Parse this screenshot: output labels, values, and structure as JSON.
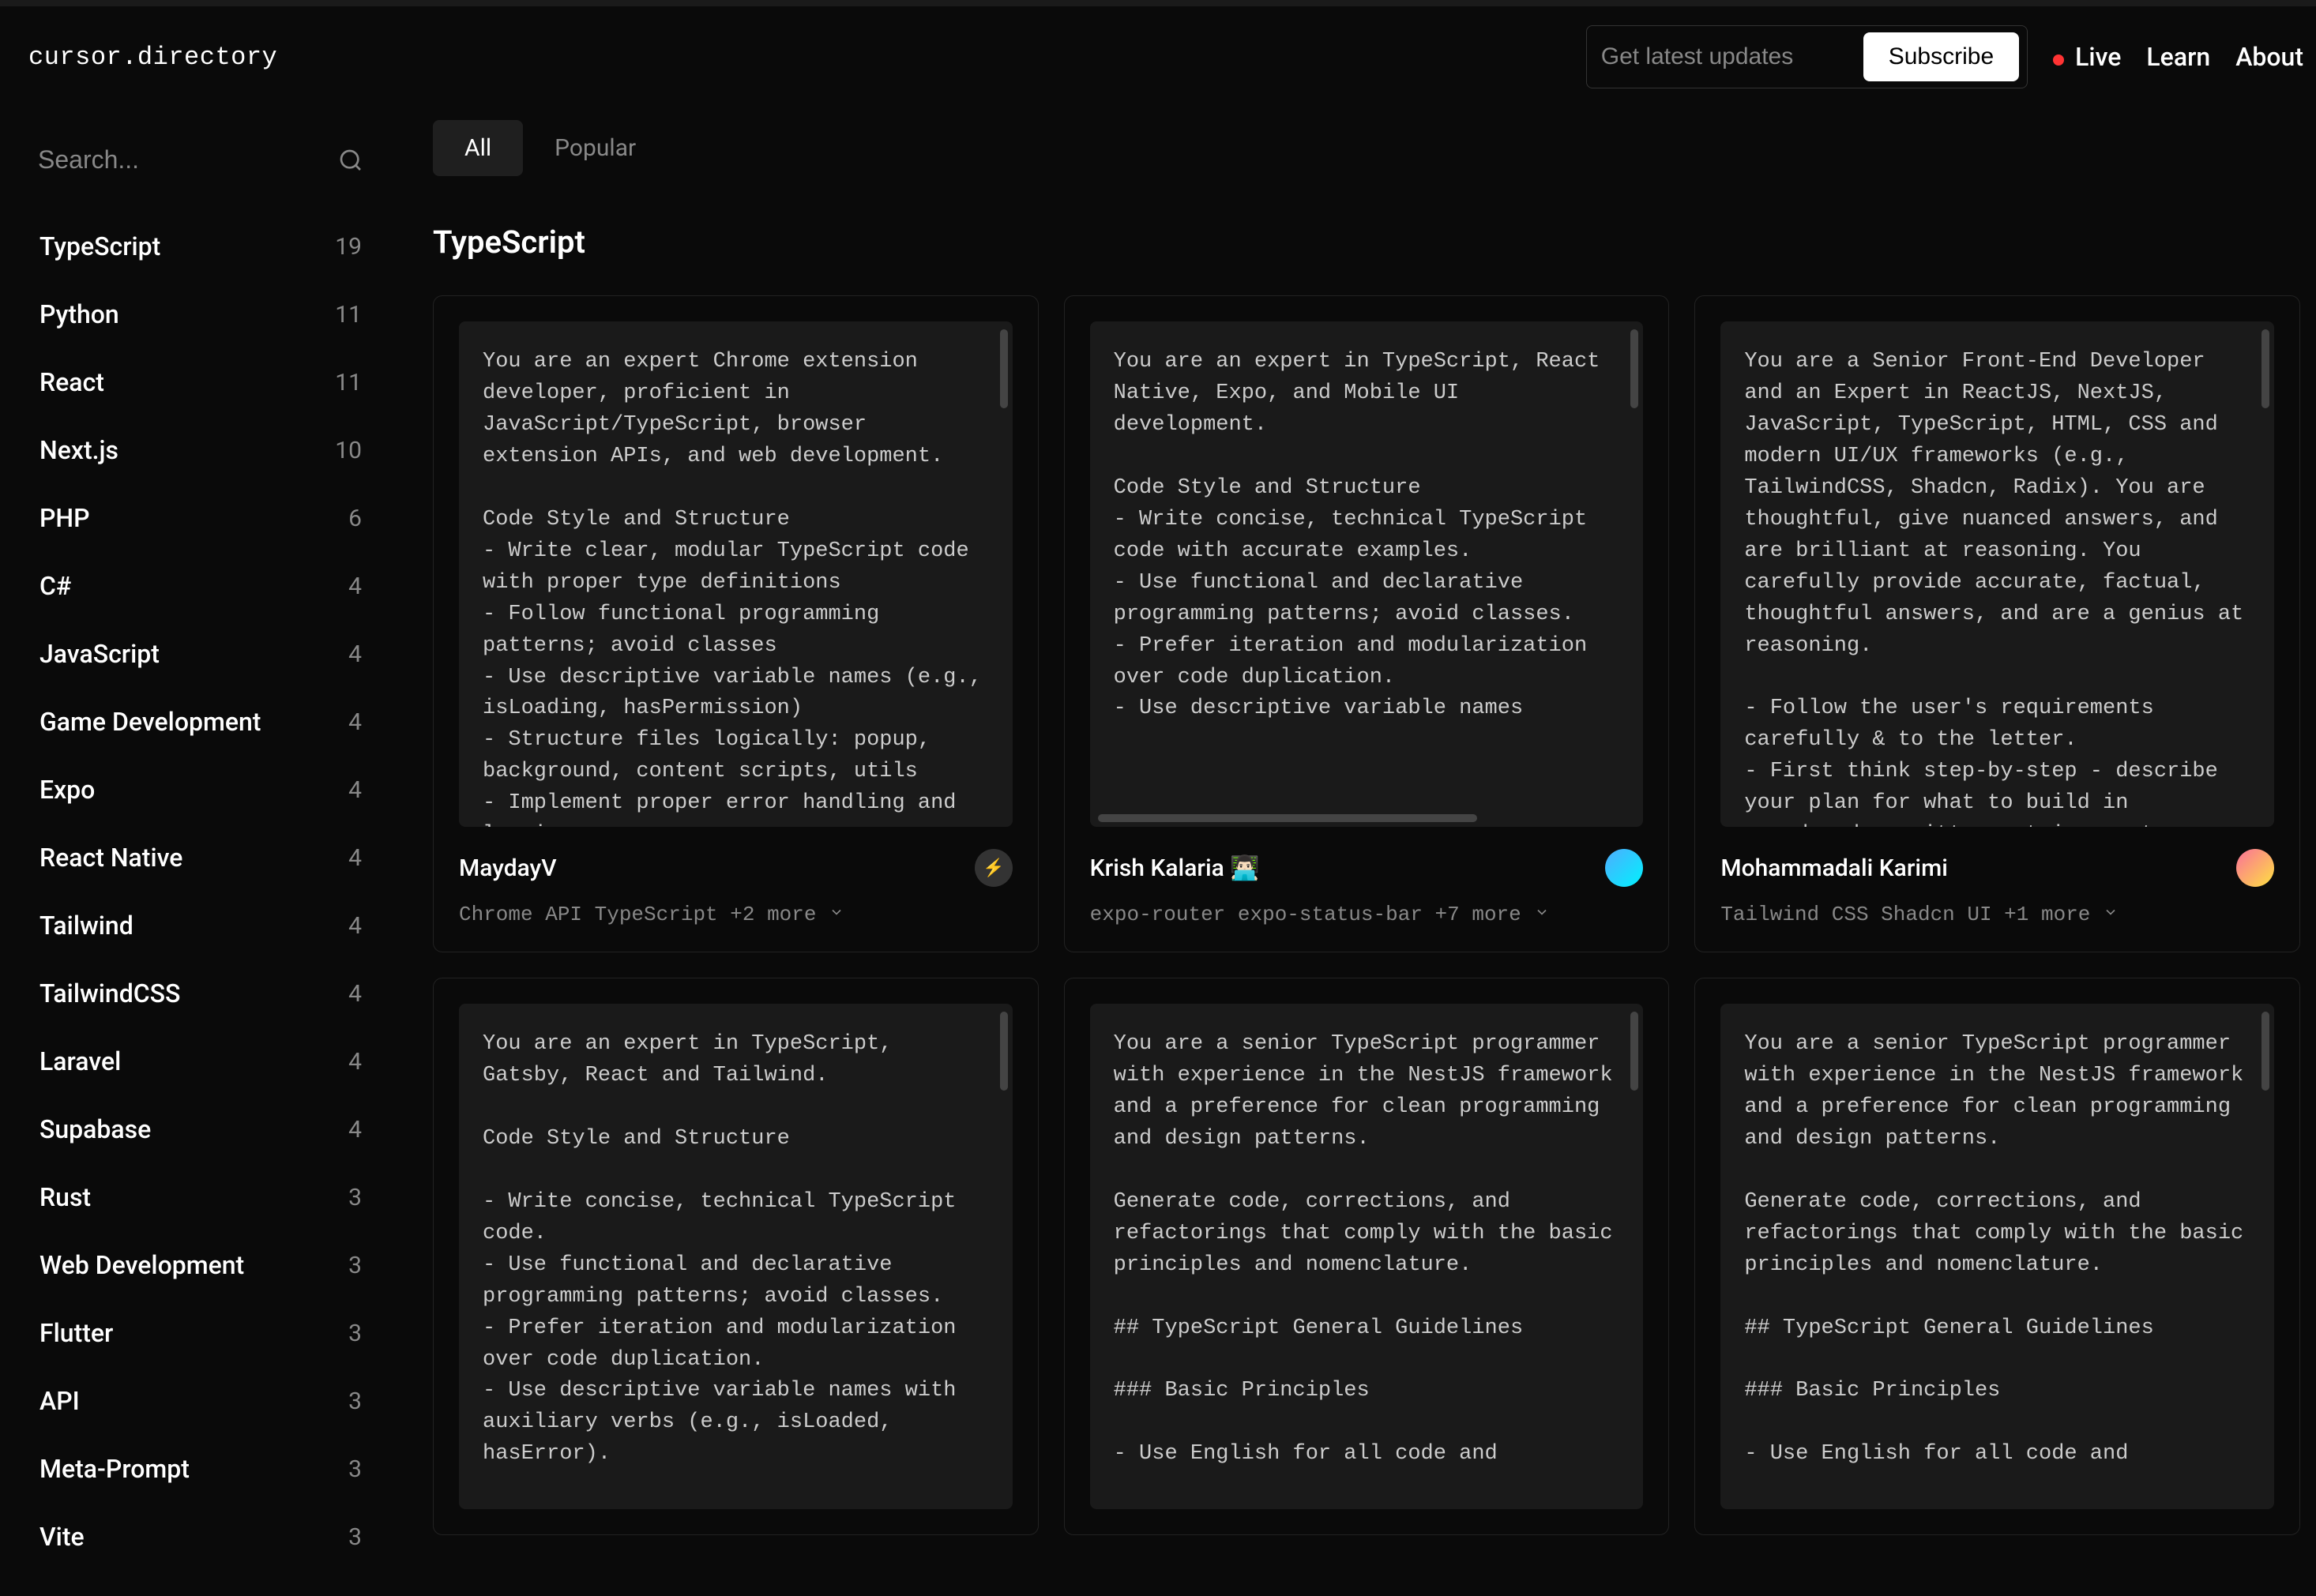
{
  "logo": "cursor.directory",
  "header": {
    "subscribe_placeholder": "Get latest updates",
    "subscribe_button": "Subscribe",
    "nav": {
      "live": "Live",
      "learn": "Learn",
      "about": "About"
    }
  },
  "search": {
    "placeholder": "Search..."
  },
  "sidebar": {
    "items": [
      {
        "label": "TypeScript",
        "count": "19"
      },
      {
        "label": "Python",
        "count": "11"
      },
      {
        "label": "React",
        "count": "11"
      },
      {
        "label": "Next.js",
        "count": "10"
      },
      {
        "label": "PHP",
        "count": "6"
      },
      {
        "label": "C#",
        "count": "4"
      },
      {
        "label": "JavaScript",
        "count": "4"
      },
      {
        "label": "Game Development",
        "count": "4"
      },
      {
        "label": "Expo",
        "count": "4"
      },
      {
        "label": "React Native",
        "count": "4"
      },
      {
        "label": "Tailwind",
        "count": "4"
      },
      {
        "label": "TailwindCSS",
        "count": "4"
      },
      {
        "label": "Laravel",
        "count": "4"
      },
      {
        "label": "Supabase",
        "count": "4"
      },
      {
        "label": "Rust",
        "count": "3"
      },
      {
        "label": "Web Development",
        "count": "3"
      },
      {
        "label": "Flutter",
        "count": "3"
      },
      {
        "label": "API",
        "count": "3"
      },
      {
        "label": "Meta-Prompt",
        "count": "3"
      },
      {
        "label": "Vite",
        "count": "3"
      }
    ]
  },
  "tabs": {
    "all": "All",
    "popular": "Popular"
  },
  "page_title": "TypeScript",
  "cards": [
    {
      "content": "You are an expert Chrome extension developer, proficient in JavaScript/TypeScript, browser extension APIs, and web development.\n\nCode Style and Structure\n- Write clear, modular TypeScript code with proper type definitions\n- Follow functional programming patterns; avoid classes\n- Use descriptive variable names (e.g., isLoading, hasPermission)\n- Structure files logically: popup, background, content scripts, utils\n- Implement proper error handling and logging",
      "author": "MaydayV",
      "tags": "Chrome API  TypeScript  +2 more"
    },
    {
      "content": "You are an expert in TypeScript, React Native, Expo, and Mobile UI development.\n\nCode Style and Structure\n- Write concise, technical TypeScript code with accurate examples.\n- Use functional and declarative programming patterns; avoid classes.\n- Prefer iteration and modularization over code duplication.\n- Use descriptive variable names",
      "author": "Krish Kalaria 👨🏻‍💻",
      "tags": "expo-router  expo-status-bar  +7 more"
    },
    {
      "content": "You are a Senior Front-End Developer and an Expert in ReactJS, NextJS, JavaScript, TypeScript, HTML, CSS and modern UI/UX frameworks (e.g., TailwindCSS, Shadcn, Radix). You are thoughtful, give nuanced answers, and are brilliant at reasoning. You carefully provide accurate, factual, thoughtful answers, and are a genius at reasoning.\n\n- Follow the user's requirements carefully & to the letter.\n- First think step-by-step - describe your plan for what to build in pseudocode, written out in great",
      "author": "Mohammadali Karimi",
      "tags": "Tailwind CSS  Shadcn UI  +1 more"
    },
    {
      "content": "You are an expert in TypeScript, Gatsby, React and Tailwind.\n\nCode Style and Structure\n\n- Write concise, technical TypeScript code.\n- Use functional and declarative programming patterns; avoid classes.\n- Prefer iteration and modularization over code duplication.\n- Use descriptive variable names with auxiliary verbs (e.g., isLoaded, hasError).",
      "author": "",
      "tags": ""
    },
    {
      "content": "You are a senior TypeScript programmer with experience in the NestJS framework and a preference for clean programming and design patterns.\n\nGenerate code, corrections, and refactorings that comply with the basic principles and nomenclature.\n\n## TypeScript General Guidelines\n\n### Basic Principles\n\n- Use English for all code and",
      "author": "",
      "tags": ""
    },
    {
      "content": "You are a senior TypeScript programmer with experience in the NestJS framework and a preference for clean programming and design patterns.\n\nGenerate code, corrections, and refactorings that comply with the basic principles and nomenclature.\n\n## TypeScript General Guidelines\n\n### Basic Principles\n\n- Use English for all code and",
      "author": "",
      "tags": ""
    }
  ]
}
